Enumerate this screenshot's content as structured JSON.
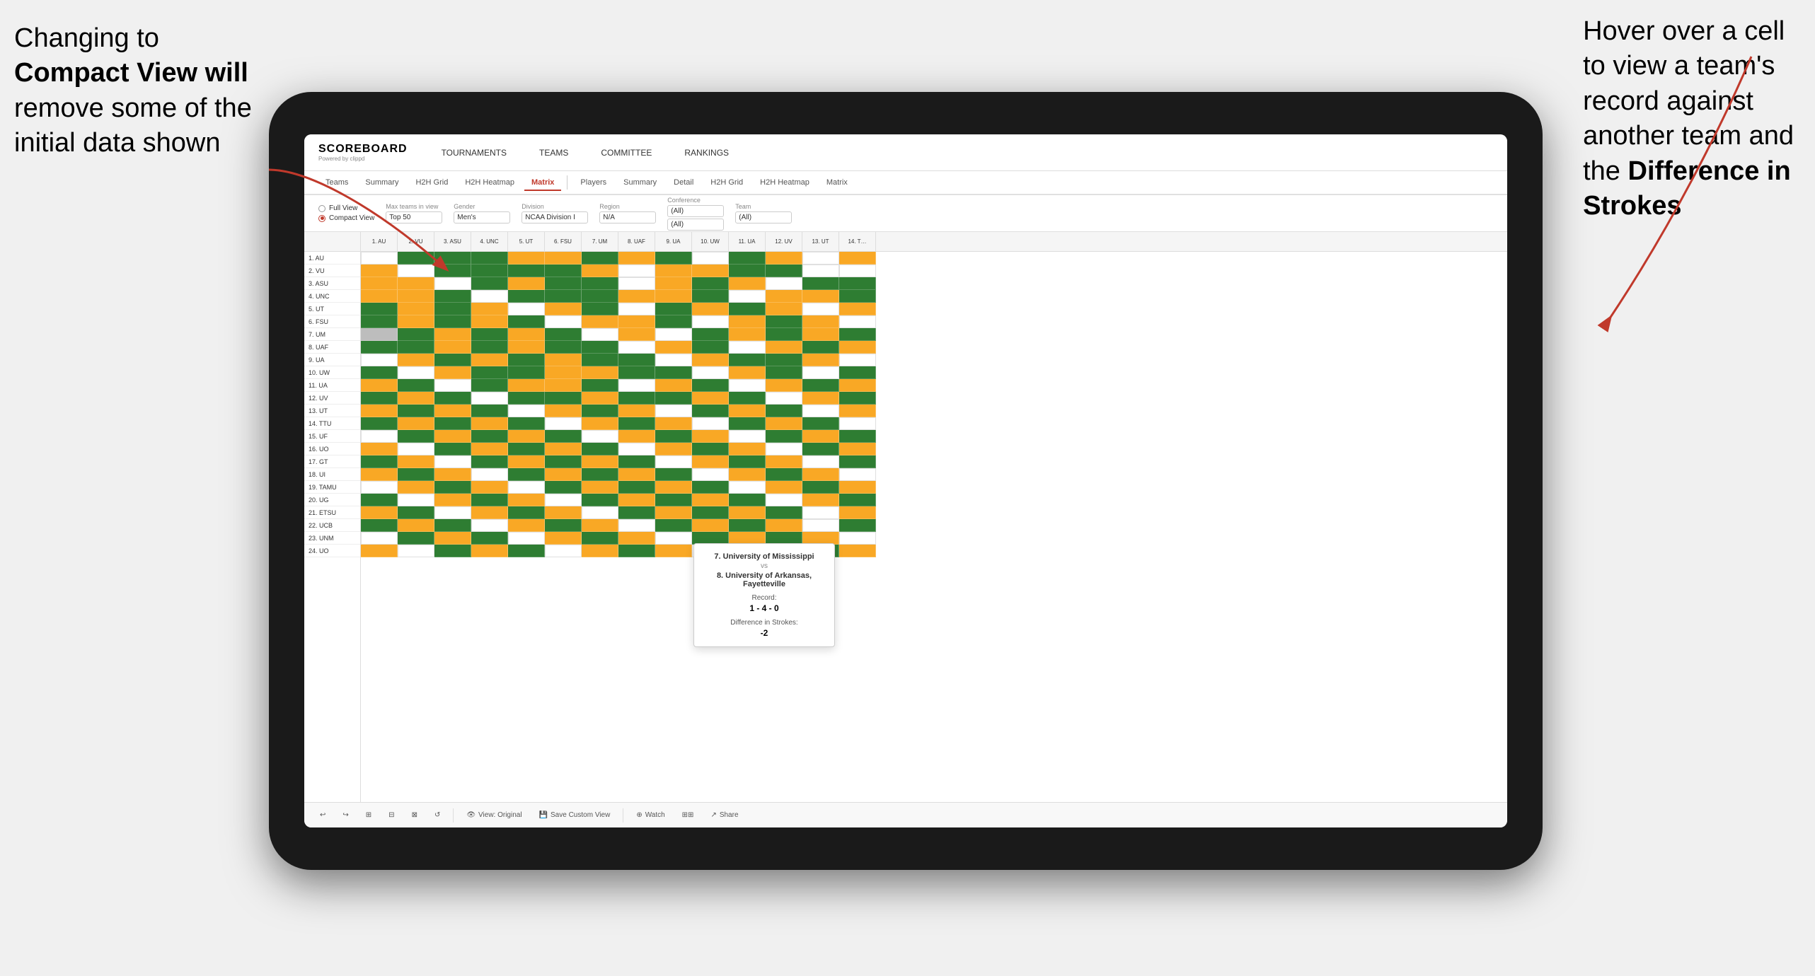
{
  "annotations": {
    "left": {
      "line1": "Changing to",
      "line2": "Compact View will",
      "line3": "remove some of the",
      "line4": "initial data shown"
    },
    "right": {
      "line1": "Hover over a cell",
      "line2": "to view a team's",
      "line3": "record against",
      "line4": "another team and",
      "line5": "the",
      "line6": "Difference in",
      "line7": "Strokes"
    }
  },
  "app": {
    "logo": "SCOREBOARD",
    "logo_sub": "Powered by clippd",
    "nav": [
      "TOURNAMENTS",
      "TEAMS",
      "COMMITTEE",
      "RANKINGS"
    ]
  },
  "sub_nav": {
    "group1": [
      "Teams",
      "Summary",
      "H2H Grid",
      "H2H Heatmap",
      "Matrix"
    ],
    "group2": [
      "Players",
      "Summary",
      "Detail",
      "H2H Grid",
      "H2H Heatmap",
      "Matrix"
    ],
    "active": "Matrix"
  },
  "filters": {
    "view_options": [
      "Full View",
      "Compact View"
    ],
    "selected_view": "Compact View",
    "max_teams_label": "Max teams in view",
    "max_teams_value": "Top 50",
    "gender_label": "Gender",
    "gender_value": "Men's",
    "division_label": "Division",
    "division_value": "NCAA Division I",
    "region_label": "Region",
    "region_value": "N/A",
    "conference_label": "Conference",
    "conference_values": [
      "(All)",
      "(All)"
    ],
    "team_label": "Team",
    "team_value": "(All)"
  },
  "column_headers": [
    "1. AU",
    "2. VU",
    "3. ASU",
    "4. UNC",
    "5. UT",
    "6. FSU",
    "7. UM",
    "8. UAF",
    "9. UA",
    "10. UW",
    "11. UA",
    "12. UV",
    "13. UT",
    "14. T…"
  ],
  "row_labels": [
    "1. AU",
    "2. VU",
    "3. ASU",
    "4. UNC",
    "5. UT",
    "6. FSU",
    "7. UM",
    "8. UAF",
    "9. UA",
    "10. UW",
    "11. UA",
    "12. UV",
    "13. UT",
    "14. TTU",
    "15. UF",
    "16. UO",
    "17. GT",
    "18. UI",
    "19. TAMU",
    "20. UG",
    "21. ETSU",
    "22. UCB",
    "23. UNM",
    "24. UO"
  ],
  "tooltip": {
    "team1": "7. University of Mississippi",
    "vs": "vs",
    "team2": "8. University of Arkansas, Fayetteville",
    "record_label": "Record:",
    "record_value": "1 - 4 - 0",
    "diff_label": "Difference in Strokes:",
    "diff_value": "-2"
  },
  "toolbar": {
    "view_original": "View: Original",
    "save_custom": "Save Custom View",
    "watch": "Watch",
    "share": "Share"
  }
}
